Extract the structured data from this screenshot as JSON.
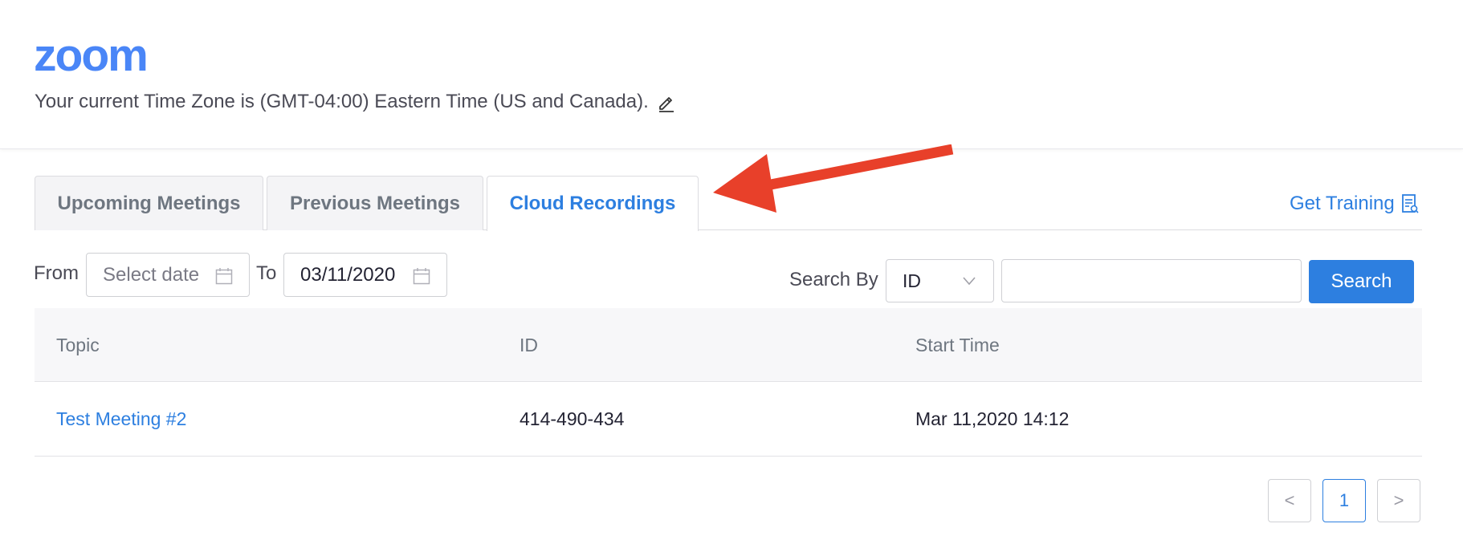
{
  "header": {
    "logo": "zoom",
    "timezone_text": "Your current Time Zone is (GMT-04:00) Eastern Time (US and Canada).",
    "edit_icon": "pencil-icon"
  },
  "tabs": [
    {
      "label": "Upcoming Meetings",
      "active": false
    },
    {
      "label": "Previous Meetings",
      "active": false
    },
    {
      "label": "Cloud Recordings",
      "active": true
    }
  ],
  "training": {
    "label": "Get Training",
    "icon": "training-doc-icon"
  },
  "filters": {
    "from_label": "From",
    "from_placeholder": "Select date",
    "to_label": "To",
    "to_value": "03/11/2020",
    "search_by_label": "Search By",
    "search_by_value": "ID",
    "search_value": "",
    "search_button": "Search"
  },
  "table": {
    "columns": [
      "Topic",
      "ID",
      "Start Time"
    ],
    "rows": [
      {
        "topic": "Test Meeting #2",
        "id": "414-490-434",
        "start_time": "Mar 11,2020 14:12"
      }
    ]
  },
  "pagination": {
    "prev": "<",
    "current": "1",
    "next": ">"
  },
  "colors": {
    "accent": "#2d7fe0",
    "logo": "#4a86f7",
    "annotation_arrow": "#e8402a"
  }
}
